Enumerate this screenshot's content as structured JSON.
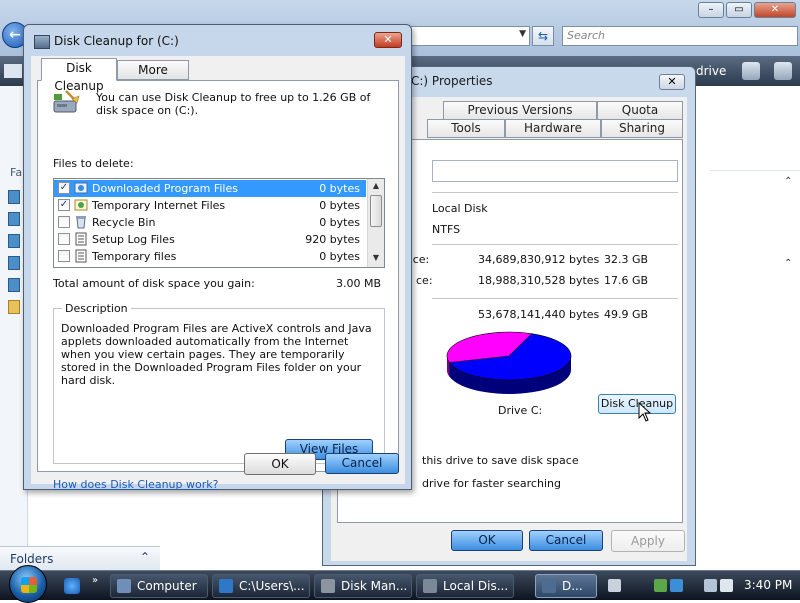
{
  "explorer": {
    "search_placeholder": "Search",
    "toolbar_text": "drive",
    "nav_label_fa": "Fa",
    "folders_label": "Folders"
  },
  "properties": {
    "title": "C:) Properties",
    "tabs_row1": [
      "Previous Versions",
      "Quota"
    ],
    "tabs_row2": [
      "Tools",
      "Hardware",
      "Sharing"
    ],
    "type": "Local Disk",
    "filesystem": "NTFS",
    "used_label": "ace:",
    "used_bytes": "34,689,830,912 bytes",
    "used_gb": "32.3 GB",
    "free_label": "ce:",
    "free_bytes": "18,988,310,528 bytes",
    "free_gb": "17.6 GB",
    "capacity_bytes": "53,678,141,440 bytes",
    "capacity_gb": "49.9 GB",
    "drive_label": "Drive C:",
    "disk_cleanup_button": "Disk Cleanup",
    "compress_text": "this drive to save disk space",
    "index_text": "drive for faster searching",
    "ok": "OK",
    "cancel": "Cancel",
    "apply": "Apply",
    "pie": {
      "used_fraction": 0.646,
      "free_fraction": 0.354,
      "used_color": "#0000ff",
      "free_color": "#ff00ff"
    }
  },
  "cleanup": {
    "title": "Disk Cleanup for  (C:)",
    "tabs": [
      "Disk Cleanup",
      "More Options"
    ],
    "intro": "You can use Disk Cleanup to free up to 1.26 GB of disk space on  (C:).",
    "files_to_delete": "Files to delete:",
    "files": [
      {
        "name": "Downloaded Program Files",
        "size": "0 bytes",
        "checked": true,
        "selected": true
      },
      {
        "name": "Temporary Internet Files",
        "size": "0 bytes",
        "checked": true,
        "selected": false
      },
      {
        "name": "Recycle Bin",
        "size": "0 bytes",
        "checked": false,
        "selected": false
      },
      {
        "name": "Setup Log Files",
        "size": "920 bytes",
        "checked": false,
        "selected": false
      },
      {
        "name": "Temporary files",
        "size": "0 bytes",
        "checked": false,
        "selected": false
      }
    ],
    "total_label": "Total amount of disk space you gain:",
    "total_value": "3.00 MB",
    "description_label": "Description",
    "description": "Downloaded Program Files are ActiveX controls and Java applets downloaded automatically from the Internet when you view certain pages. They are temporarily stored in the Downloaded Program Files folder on your hard disk.",
    "view_files": "View Files",
    "help_link": "How does Disk Cleanup work?",
    "ok": "OK",
    "cancel": "Cancel"
  },
  "taskbar": {
    "buttons": [
      {
        "label": "Computer",
        "active": false
      },
      {
        "label": "C:\\Users\\...",
        "active": false
      },
      {
        "label": "Disk Man...",
        "active": false
      },
      {
        "label": "Local Dis...",
        "active": false
      },
      {
        "label": "D...",
        "active": true
      }
    ],
    "clock": "3:40 PM"
  }
}
